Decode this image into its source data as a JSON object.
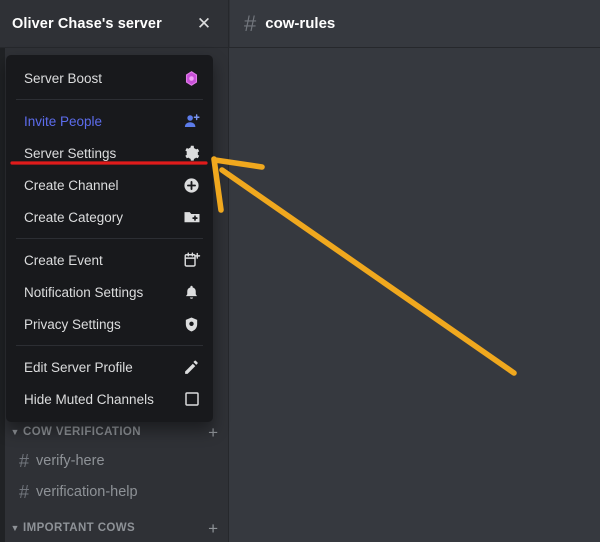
{
  "header": {
    "server_name": "Oliver Chase's server",
    "close_icon": "close-icon",
    "channel_hash": "#",
    "channel_name": "cow-rules"
  },
  "context_menu": {
    "items": [
      {
        "label": "Server Boost",
        "icon": "boost-diamond-icon",
        "accent": false,
        "separator_after": true
      },
      {
        "label": "Invite People",
        "icon": "person-add-icon",
        "accent": true,
        "separator_after": false
      },
      {
        "label": "Server Settings",
        "icon": "gear-icon",
        "accent": false,
        "separator_after": false
      },
      {
        "label": "Create Channel",
        "icon": "plus-circle-icon",
        "accent": false,
        "separator_after": false
      },
      {
        "label": "Create Category",
        "icon": "folder-plus-icon",
        "accent": false,
        "separator_after": false
      },
      {
        "label": "Create Event",
        "icon": "calendar-plus-icon",
        "accent": false,
        "separator_after": true
      },
      {
        "label": "Notification Settings",
        "icon": "bell-icon",
        "accent": false,
        "separator_after": false
      },
      {
        "label": "Privacy Settings",
        "icon": "shield-icon",
        "accent": false,
        "separator_after": true
      },
      {
        "label": "Edit Server Profile",
        "icon": "pencil-icon",
        "accent": false,
        "separator_after": false
      },
      {
        "label": "Hide Muted Channels",
        "icon": "checkbox-empty-icon",
        "accent": false,
        "separator_after": false
      }
    ]
  },
  "sidebar": {
    "categories": [
      {
        "label": "COW VERIFICATION",
        "collapse_icon": "chevron-down-icon",
        "add_icon": "plus-icon",
        "channels": [
          {
            "hash": "#",
            "name": "verify-here"
          },
          {
            "hash": "#",
            "name": "verification-help"
          }
        ]
      },
      {
        "label": "IMPORTANT COWS",
        "collapse_icon": "chevron-down-icon",
        "add_icon": "plus-icon",
        "channels": []
      }
    ]
  },
  "annotations": {
    "underline_color": "#e01b1b",
    "arrow_color": "#f0a81e",
    "underline_target": "Server Settings",
    "arrow_points_to": "Server Settings"
  },
  "colors": {
    "menu_bg": "#18191c",
    "sidebar_bg": "#2f3136",
    "content_bg": "#36393f",
    "accent_blue": "#5c6cec",
    "boost_pink": "#ca50d8"
  }
}
